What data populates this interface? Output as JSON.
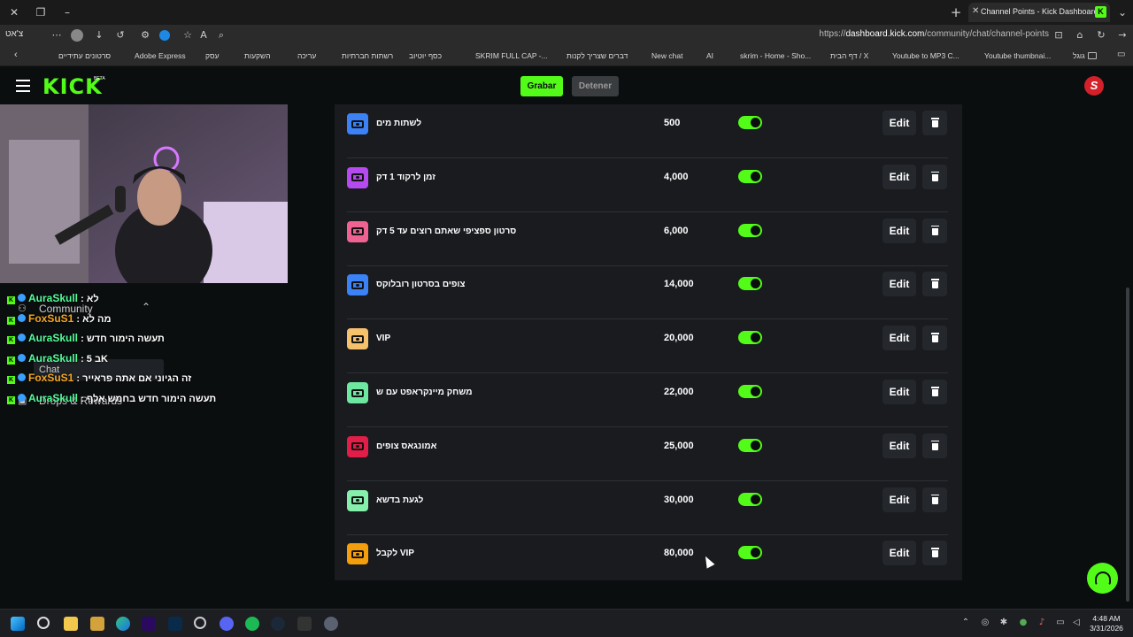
{
  "browser": {
    "tab_title": "Channel Points - Kick Dashboard",
    "url_prefix": "https://",
    "url_domain": "dashboard.kick.com",
    "url_path": "/community/chat/channel-points",
    "profile_label": "צ'אט",
    "bookmarks": [
      "גוגל",
      "Youtube thumbnai...",
      "Youtube to MP3 C...",
      "דף הבית / X",
      "skrim - Home - Sho...",
      "AI",
      "New chat",
      "דברים שצריך לקנות",
      "SKRIM FULL CAP -...",
      "כסף יוטיוב",
      "רשתות חברתיות",
      "עריכה",
      "השקעות",
      "עסק",
      "Adobe Express",
      "סרטונים עתידיים"
    ]
  },
  "header": {
    "logo": "KICK",
    "beta": "BETA",
    "grabar_label": "Grabar",
    "detener_label": "Detener",
    "avatar_letter": "S"
  },
  "sidebar": {
    "community_label": "Community",
    "chat_label": "Chat",
    "drops_label": "Drops & Rewards"
  },
  "chat_overlay": [
    {
      "name": "AuraSkull",
      "color": "#53fc9a",
      "message": ": לא"
    },
    {
      "name": "FoxSuS1",
      "color": "#f5a623",
      "message": ": מה לא"
    },
    {
      "name": "AuraSkull",
      "color": "#53fc9a",
      "message": ": תעשה הימור חדש"
    },
    {
      "name": "AuraSkull",
      "color": "#53fc9a",
      "message": ": 5 בK"
    },
    {
      "name": "FoxSuS1",
      "color": "#f5a623",
      "message": ": זה הגיוני אם אתה פראייר"
    },
    {
      "name": "AuraSkull",
      "color": "#53fc9a",
      "message": ": תעשה הימור חדש בחמש אלף"
    }
  ],
  "rewards": [
    {
      "title": "לשתות מים",
      "cost": "500",
      "color": "#3b82f6",
      "enabled": true,
      "edit_label": "Edit"
    },
    {
      "title": "זמן לרקוד 1 דק",
      "cost": "4,000",
      "color": "#b44af0",
      "enabled": true,
      "edit_label": "Edit"
    },
    {
      "title": "סרטון ספציפי שאתם רוצים עד 5 דק",
      "cost": "6,000",
      "color": "#f06292",
      "enabled": true,
      "edit_label": "Edit"
    },
    {
      "title": "צופים בסרטון רובלוקס",
      "cost": "14,000",
      "color": "#3b82f6",
      "enabled": true,
      "edit_label": "Edit"
    },
    {
      "title": "VIP",
      "cost": "20,000",
      "color": "#f5c16c",
      "enabled": true,
      "edit_label": "Edit"
    },
    {
      "title": "משחק מיינקראפט עם ש",
      "cost": "22,000",
      "color": "#6ee7a0",
      "enabled": true,
      "edit_label": "Edit"
    },
    {
      "title": "אמונגאס צופים",
      "cost": "25,000",
      "color": "#e11d48",
      "enabled": true,
      "edit_label": "Edit"
    },
    {
      "title": "לגעת בדשא",
      "cost": "30,000",
      "color": "#86efac",
      "enabled": true,
      "edit_label": "Edit"
    },
    {
      "title": "לקבל VIP",
      "cost": "80,000",
      "color": "#f59e0b",
      "enabled": true,
      "edit_label": "Edit"
    }
  ],
  "taskbar": {
    "time": "4:48 AM",
    "date": "3/31/2026"
  }
}
